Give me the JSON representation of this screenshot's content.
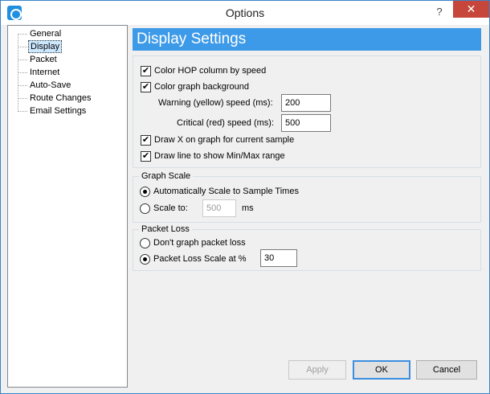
{
  "window": {
    "title": "Options",
    "help": "?",
    "close": "✕"
  },
  "tree": {
    "items": [
      {
        "label": "General"
      },
      {
        "label": "Display"
      },
      {
        "label": "Packet"
      },
      {
        "label": "Internet"
      },
      {
        "label": "Auto-Save"
      },
      {
        "label": "Route Changes"
      },
      {
        "label": "Email Settings"
      }
    ],
    "selected": "Display"
  },
  "display": {
    "heading": "Display Settings",
    "color_hop": {
      "label": "Color HOP column by speed",
      "checked": true
    },
    "color_bg": {
      "label": "Color graph background",
      "checked": true
    },
    "warning_label": "Warning (yellow) speed (ms):",
    "warning_value": "200",
    "critical_label": "Critical (red) speed (ms):",
    "critical_value": "500",
    "draw_x": {
      "label": "Draw X on graph for current sample",
      "checked": true
    },
    "draw_line": {
      "label": "Draw line to show Min/Max range",
      "checked": true
    }
  },
  "graph_scale": {
    "legend": "Graph Scale",
    "auto_label": "Automatically Scale to Sample Times",
    "scale_to_label": "Scale to:",
    "scale_value": "500",
    "unit": "ms",
    "selected": "auto"
  },
  "packet_loss": {
    "legend": "Packet Loss",
    "dont_graph_label": "Don't graph packet loss",
    "scale_label": "Packet Loss Scale at %",
    "scale_value": "30",
    "selected": "scale"
  },
  "buttons": {
    "apply": "Apply",
    "ok": "OK",
    "cancel": "Cancel"
  },
  "colors": {
    "accent": "#3d9ae8",
    "close": "#c7463c"
  }
}
